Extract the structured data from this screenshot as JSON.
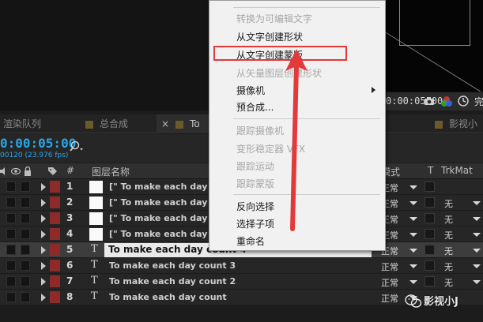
{
  "viewer": {
    "time": "0:00:05:00",
    "more_label": "完"
  },
  "tabs": [
    {
      "label": "渲染队列",
      "color": "#6b5a2a"
    },
    {
      "label": "总合成",
      "color": "#6b5a2a"
    },
    {
      "label": "To m",
      "color": "#6b5a2a",
      "close": "×"
    },
    {
      "label": "影视小",
      "color": "#6b5a2a"
    }
  ],
  "timeline": {
    "current_time": "0:00:05:00",
    "fps": "00120 (23.976 fps)"
  },
  "columns": {
    "number": "#",
    "layer_name": "图层名称",
    "mode": "模式",
    "t": "T",
    "trkmat": "TrkMat"
  },
  "layers": [
    {
      "num": "1",
      "type": "precomp",
      "name": "[\" To make each day co",
      "mode": "正常",
      "trkmat": ""
    },
    {
      "num": "2",
      "type": "precomp",
      "name": "[\" To make each day co",
      "mode": "正常",
      "trkmat": "无"
    },
    {
      "num": "3",
      "type": "precomp",
      "name": "[\" To make each day co",
      "mode": "正常",
      "trkmat": "无"
    },
    {
      "num": "4",
      "type": "precomp",
      "name": "[\" To make each day co",
      "mode": "正常",
      "trkmat": "无"
    },
    {
      "num": "5",
      "type": "text",
      "name": "To make each day count 4",
      "mode": "正常",
      "trkmat": "无",
      "selected": true
    },
    {
      "num": "6",
      "type": "text",
      "name": "To make each day count 3",
      "mode": "正常",
      "trkmat": "无"
    },
    {
      "num": "7",
      "type": "text",
      "name": "To make each day count 2",
      "mode": "正常",
      "trkmat": "无"
    },
    {
      "num": "8",
      "type": "text",
      "name": "To make each day count",
      "mode": "正常",
      "trkmat": ""
    }
  ],
  "context_menu": {
    "items": [
      {
        "label": "转换为可编辑文字",
        "disabled": true
      },
      {
        "label": "从文字创建形状",
        "disabled": false
      },
      {
        "label": "从文字创建蒙版",
        "disabled": false,
        "highlighted": true
      },
      {
        "label": "从矢量图层创建形状",
        "disabled": true
      },
      {
        "label": "摄像机",
        "disabled": false,
        "submenu": true
      },
      {
        "label": "预合成...",
        "disabled": false
      },
      {
        "label": "跟踪摄像机",
        "disabled": true
      },
      {
        "label": "变形稳定器 VFX",
        "disabled": true
      },
      {
        "label": "跟踪运动",
        "disabled": true
      },
      {
        "label": "跟踪蒙版",
        "disabled": true
      },
      {
        "label": "反向选择",
        "disabled": false
      },
      {
        "label": "选择子项",
        "disabled": false
      },
      {
        "label": "重命名",
        "disabled": false
      }
    ]
  },
  "annotation": {
    "highlight_color": "#e23a3a"
  },
  "watermark": {
    "text": "影视小J"
  }
}
